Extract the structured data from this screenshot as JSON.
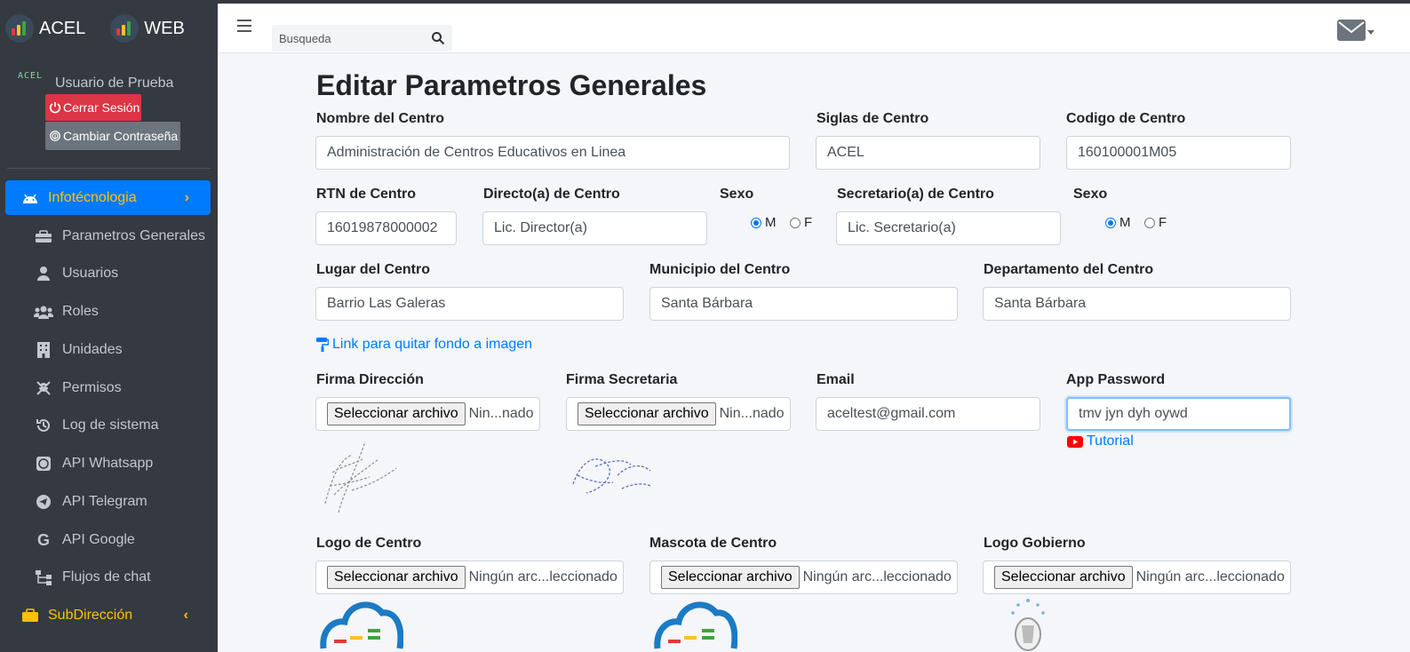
{
  "brand": {
    "left": "ACEL",
    "right": "WEB"
  },
  "user": {
    "avatar_text": "ACEL",
    "name": "Usuario de Prueba",
    "logout": "Cerrar Sesión",
    "change_password": "Cambiar Contraseña"
  },
  "sidebar": {
    "active_section": "Infotécnologia",
    "items": [
      {
        "label": "Parametros Generales",
        "icon": "toolbox-icon"
      },
      {
        "label": "Usuarios",
        "icon": "user-icon"
      },
      {
        "label": "Roles",
        "icon": "users-icon"
      },
      {
        "label": "Unidades",
        "icon": "building-icon"
      },
      {
        "label": "Permisos",
        "icon": "user-secret-icon"
      },
      {
        "label": "Log de sistema",
        "icon": "history-icon"
      },
      {
        "label": "API Whatsapp",
        "icon": "whatsapp-icon"
      },
      {
        "label": "API Telegram",
        "icon": "telegram-icon"
      },
      {
        "label": "API Google",
        "icon": "google-icon"
      },
      {
        "label": "Flujos de chat",
        "icon": "sitemap-icon"
      }
    ],
    "sub_section": "SubDirección"
  },
  "search": {
    "placeholder": "Busqueda"
  },
  "page_title": "Editar Parametros Generales",
  "form": {
    "nombre_label": "Nombre del Centro",
    "nombre_value": "Administración de Centros Educativos en Linea",
    "siglas_label": "Siglas de Centro",
    "siglas_value": "ACEL",
    "codigo_label": "Codigo de Centro",
    "codigo_value": "160100001M05",
    "rtn_label": "RTN de Centro",
    "rtn_value": "16019878000002",
    "director_label": "Directo(a) de Centro",
    "director_value": "Lic. Director(a)",
    "sexo1_label": "Sexo",
    "sexo_m": "M",
    "sexo_f": "F",
    "secretario_label": "Secretario(a) de Centro",
    "secretario_value": "Lic. Secretario(a)",
    "sexo2_label": "Sexo",
    "lugar_label": "Lugar del Centro",
    "lugar_value": "Barrio Las Galeras",
    "municipio_label": "Municipio del Centro",
    "municipio_value": "Santa Bárbara",
    "departamento_label": "Departamento del Centro",
    "departamento_value": "Santa Bárbara",
    "link_fondo": "Link para quitar fondo a imagen",
    "firma_dir_label": "Firma Dirección",
    "firma_sec_label": "Firma Secretaria",
    "email_label": "Email",
    "email_value": "aceltest@gmail.com",
    "app_password_label": "App Password",
    "app_password_value": "tmv jyn dyh oywd",
    "tutorial": "Tutorial",
    "logo_centro_label": "Logo de Centro",
    "mascota_label": "Mascota de Centro",
    "logo_gob_label": "Logo Gobierno",
    "file_button": "Seleccionar archivo",
    "file_none_short": "Nin...nado",
    "file_none_long": "Ningún arc...leccionado"
  },
  "colors": {
    "sidebar": "#343a40",
    "primary": "#007bff",
    "warning": "#ffc107",
    "danger": "#dc3545"
  }
}
